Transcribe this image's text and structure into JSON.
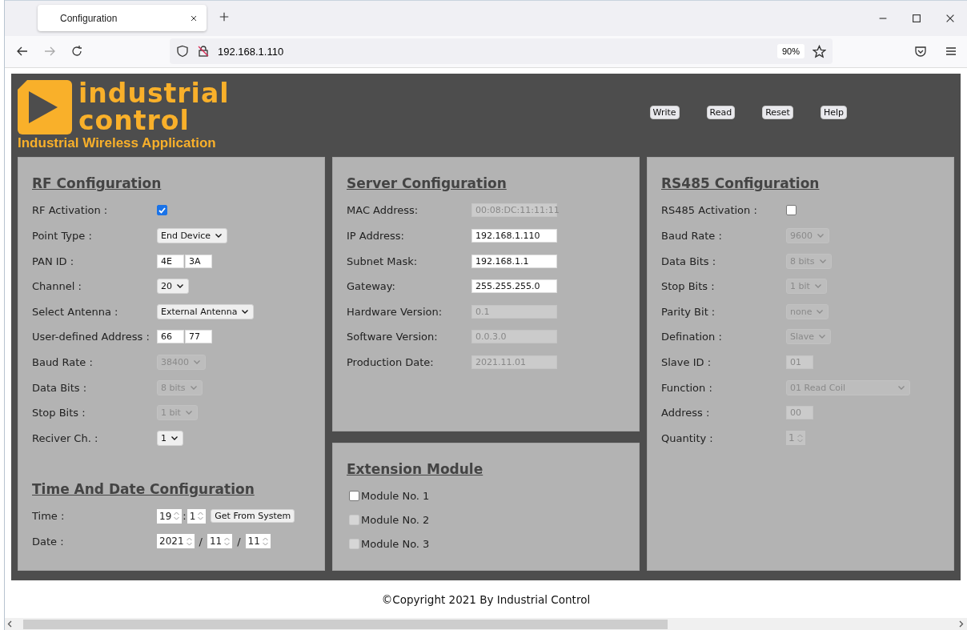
{
  "browser": {
    "tab_title": "Configuration",
    "url": "192.168.1.110",
    "zoom": "90%"
  },
  "header": {
    "logo_top": "industrial",
    "logo_bottom": "control",
    "subtitle": "Industrial Wireless Application",
    "buttons": [
      "Write",
      "Read",
      "Reset",
      "Help"
    ]
  },
  "rf": {
    "title": "RF Configuration",
    "rows": [
      {
        "label": "RF Activation :",
        "kind": "checkbox",
        "checked": true,
        "disabled": false
      },
      {
        "label": "Point Type :",
        "kind": "select",
        "value": "End Device",
        "disabled": false
      },
      {
        "label": "PAN ID :",
        "kind": "pair",
        "values": [
          "4E",
          "3A"
        ],
        "disabled": false
      },
      {
        "label": "Channel :",
        "kind": "select",
        "value": "20",
        "disabled": false
      },
      {
        "label": "Select Antenna :",
        "kind": "select",
        "value": "External Antenna",
        "disabled": false
      },
      {
        "label": "User-defined Address :",
        "kind": "pair",
        "values": [
          "66",
          "77"
        ],
        "disabled": false
      },
      {
        "label": "Baud Rate :",
        "kind": "select",
        "value": "38400",
        "disabled": true
      },
      {
        "label": "Data Bits :",
        "kind": "select",
        "value": "8 bits",
        "disabled": true
      },
      {
        "label": "Stop Bits :",
        "kind": "select",
        "value": "1 bit",
        "disabled": true
      },
      {
        "label": "Reciver Ch. :",
        "kind": "select",
        "value": "1",
        "disabled": false
      }
    ]
  },
  "time": {
    "title": "Time And Date Configuration",
    "rows": [
      {
        "label": "Time :",
        "kind": "spins",
        "parts": [
          "19",
          "1"
        ],
        "separator": ":",
        "button": "Get From System",
        "disabled": false
      },
      {
        "label": "Date :",
        "kind": "spins",
        "parts": [
          "2021",
          "11",
          "11"
        ],
        "separator": "/",
        "disabled": false
      }
    ]
  },
  "server": {
    "title": "Server Configuration",
    "rows": [
      {
        "label": "MAC Address:",
        "kind": "text",
        "value": "00:08:DC:11:11:11",
        "disabled": true
      },
      {
        "label": "IP Address:",
        "kind": "text",
        "value": "192.168.1.110",
        "disabled": false
      },
      {
        "label": "Subnet Mask:",
        "kind": "text",
        "value": "192.168.1.1",
        "disabled": false
      },
      {
        "label": "Gateway:",
        "kind": "text",
        "value": "255.255.255.0",
        "disabled": false
      },
      {
        "label": "Hardware Version:",
        "kind": "text",
        "value": "0.1",
        "disabled": true
      },
      {
        "label": "Software Version:",
        "kind": "text",
        "value": "0.0.3.0",
        "disabled": true
      },
      {
        "label": "Production Date:",
        "kind": "text",
        "value": "2021.11.01",
        "disabled": true
      }
    ]
  },
  "extension": {
    "title": "Extension Module",
    "modules": [
      {
        "label": "Module No. 1",
        "checked": false,
        "disabled": false
      },
      {
        "label": "Module No. 2",
        "checked": false,
        "disabled": true
      },
      {
        "label": "Module No. 3",
        "checked": false,
        "disabled": true
      }
    ]
  },
  "rs485": {
    "title": "RS485 Configuration",
    "rows": [
      {
        "label": "RS485 Activation :",
        "kind": "checkbox",
        "checked": false,
        "disabled": false
      },
      {
        "label": "Baud Rate :",
        "kind": "select",
        "value": "9600",
        "disabled": true
      },
      {
        "label": "Data Bits :",
        "kind": "select",
        "value": "8 bits",
        "disabled": true
      },
      {
        "label": "Stop Bits :",
        "kind": "select",
        "value": "1 bit",
        "disabled": true
      },
      {
        "label": "Parity Bit :",
        "kind": "select",
        "value": "none",
        "disabled": true
      },
      {
        "label": "Defination :",
        "kind": "select",
        "value": "Slave",
        "disabled": true
      },
      {
        "label": "Slave ID :",
        "kind": "text",
        "value": "01",
        "disabled": true
      },
      {
        "label": "Function :",
        "kind": "select",
        "value": "01 Read Coil",
        "disabled": true
      },
      {
        "label": "Address :",
        "kind": "text",
        "value": "00",
        "disabled": true
      },
      {
        "label": "Quantity :",
        "kind": "spins",
        "parts": [
          "1"
        ],
        "separator": "",
        "disabled": true
      }
    ]
  },
  "footer": "©Copyright 2021 By Industrial Control"
}
